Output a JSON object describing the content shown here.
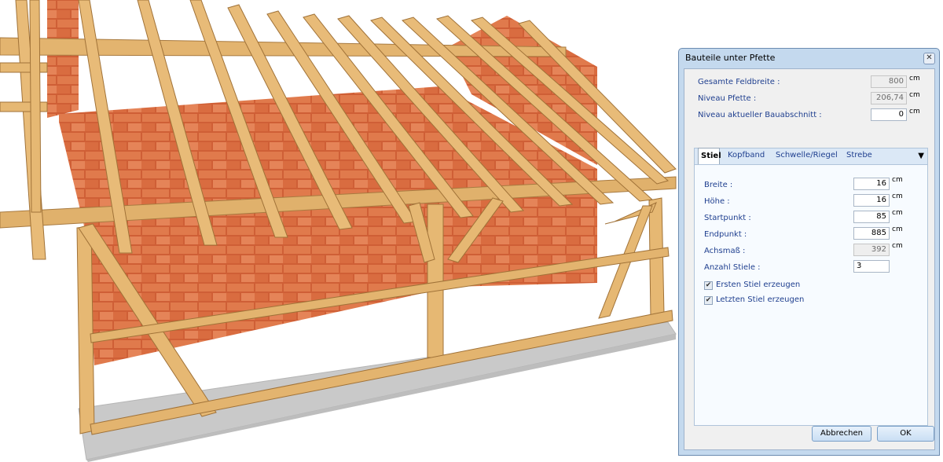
{
  "dialog": {
    "title": "Bauteile unter Pfette",
    "close_glyph": "✕",
    "fields_top": [
      {
        "label": "Gesamte Feldbreite :",
        "value": "800",
        "unit": "cm",
        "enabled": false
      },
      {
        "label": "Niveau Pfette :",
        "value": "206,74",
        "unit": "cm",
        "enabled": false
      },
      {
        "label": "Niveau aktueller Bauabschnitt :",
        "value": "0",
        "unit": "cm",
        "enabled": true
      }
    ],
    "tabs": [
      {
        "label": "Stiel",
        "active": true
      },
      {
        "label": "Kopfband",
        "active": false
      },
      {
        "label": "Schwelle/Riegel",
        "active": false
      },
      {
        "label": "Strebe",
        "active": false
      }
    ],
    "tab_dropdown_glyph": "▼",
    "fields_stiel": [
      {
        "label": "Breite :",
        "value": "16",
        "unit": "cm",
        "enabled": true
      },
      {
        "label": "Höhe :",
        "value": "16",
        "unit": "cm",
        "enabled": true
      },
      {
        "label": "Startpunkt :",
        "value": "85",
        "unit": "cm",
        "enabled": true
      },
      {
        "label": "Endpunkt :",
        "value": "885",
        "unit": "cm",
        "enabled": true
      },
      {
        "label": "Achsmaß :",
        "value": "392",
        "unit": "cm",
        "enabled": false
      },
      {
        "label": "Anzahl Stiele :",
        "value": "3",
        "unit": "",
        "enabled": true
      }
    ],
    "checkboxes": [
      {
        "label": "Ersten Stiel erzeugen",
        "checked": true
      },
      {
        "label": "Letzten Stiel erzeugen",
        "checked": true
      }
    ],
    "check_glyph": "✔",
    "buttons": {
      "cancel": "Abbrechen",
      "ok": "OK"
    }
  },
  "colors": {
    "wood": "#e2b36e",
    "wood_dark": "#b7864a",
    "brick": "#d5683f",
    "floor": "#c8c8c8",
    "dialog_frame": "#c4d9ee"
  }
}
